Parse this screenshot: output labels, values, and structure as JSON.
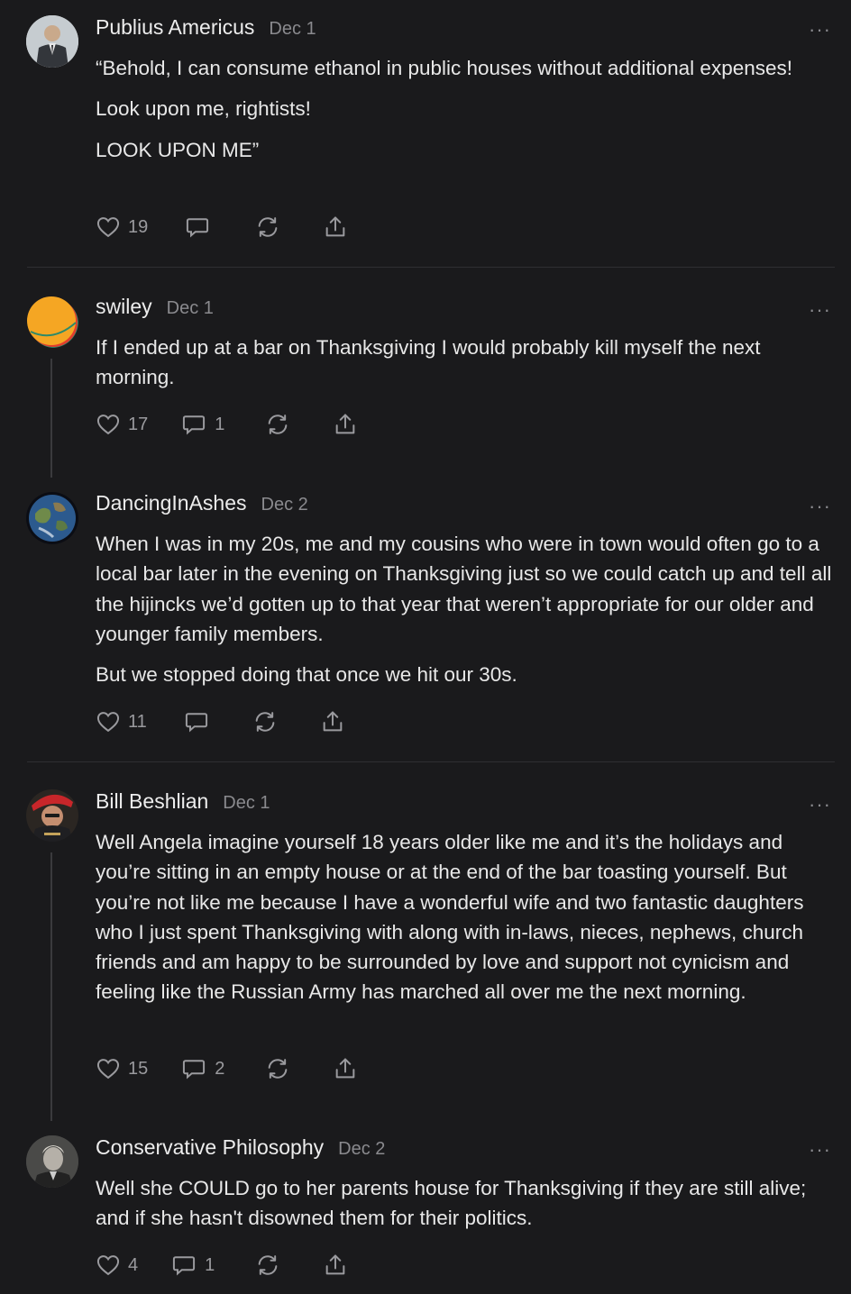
{
  "comments": [
    {
      "author": "Publius Americus",
      "date": "Dec 1",
      "paragraphs": [
        "“Behold, I can consume ethanol in public houses without additional expenses!",
        "Look upon me, rightists!",
        "LOOK UPON ME”"
      ],
      "likes": "19",
      "replies": "",
      "avatar": "man-in-suit-photo"
    },
    {
      "author": "swiley",
      "date": "Dec 1",
      "paragraphs": [
        "If I ended up at a bar on Thanksgiving I would probably kill myself the next morning."
      ],
      "likes": "17",
      "replies": "1",
      "avatar": "orange-green-circle"
    },
    {
      "author": "DancingInAshes",
      "date": "Dec 2",
      "paragraphs": [
        "When I was in my 20s, me and my cousins who were in town would often go to a local bar later in the evening on Thanksgiving just so we could catch up and tell all the hijincks we’d gotten up to that year that weren’t appropriate for our older and younger family members.",
        "But we stopped doing that once we hit our 30s."
      ],
      "likes": "11",
      "replies": "",
      "avatar": "earth-globe"
    },
    {
      "author": "Bill Beshlian",
      "date": "Dec 1",
      "paragraphs": [
        "Well Angela imagine yourself 18 years older like me and it’s the holidays and you’re sitting in an empty house or at the end of the bar toasting yourself. But you’re not like me because I have a wonderful wife and two fantastic daughters who I just spent Thanksgiving with along with in-laws, nieces, nephews, church friends and am happy to be surrounded by love and support not cynicism and feeling like the Russian Army has marched all over me the next morning."
      ],
      "likes": "15",
      "replies": "2",
      "avatar": "man-in-santa-hat"
    },
    {
      "author": "Conservative Philosophy",
      "date": "Dec 2",
      "paragraphs": [
        "Well she COULD go to her parents house for Thanksgiving if they are still alive; and if she hasn't disowned them for their politics."
      ],
      "likes": "4",
      "replies": "1",
      "avatar": "burke-portrait"
    }
  ],
  "more_glyph": "···",
  "colors": {
    "background": "#1a1a1c",
    "text": "#e8e8e8",
    "muted": "#8a8a8e"
  }
}
